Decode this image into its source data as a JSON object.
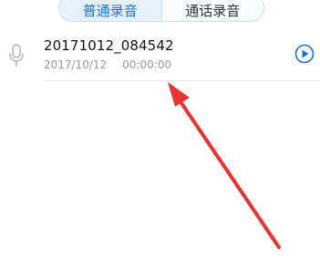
{
  "tabs": {
    "normal_label": "普通录音",
    "call_label": "通话录音"
  },
  "recording": {
    "name": "20171012_084542",
    "date": "2017/10/12",
    "duration": "00:00:00"
  },
  "colors": {
    "accent": "#1a73d9",
    "annotation_arrow": "#e8332f"
  },
  "icons": {
    "left": "microphone-icon",
    "right": "play-circle-icon"
  }
}
